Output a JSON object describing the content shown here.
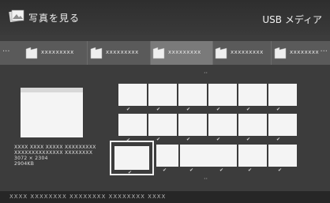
{
  "header": {
    "title": "写真を見る",
    "media": "USB メディア",
    "title_icon": "photo-icon"
  },
  "folder_strip": {
    "more_left": "···",
    "more_right": "···",
    "folders": [
      {
        "label": "xxxxxxxxx",
        "selected": false
      },
      {
        "label": "xxxxxxxxx",
        "selected": false
      },
      {
        "label": "xxxxxxxxx",
        "selected": true
      },
      {
        "label": "xxxxxxxxx",
        "selected": false
      },
      {
        "label": "xxxxxxxx",
        "selected": false
      }
    ]
  },
  "scroll": {
    "up": "··",
    "down": "··"
  },
  "preview": {
    "line1": "XXXX XXXX XXXXX XXXXXXXXX",
    "line2": "XXXXXXXXXXXXXX XXXXXXXX",
    "resolution": "3072 × 2304",
    "size": "2904KB"
  },
  "thumbnails": {
    "check_mark": "✔"
  },
  "footer": {
    "text": "XXXX  XXXXXXXX  XXXXXXXX  XXXXXXXX  XXXX"
  },
  "colors": {
    "background": "#3c3c3c",
    "folder_strip": "#5a5a5a",
    "selected_folder": "#7a7a7a",
    "thumbnail": "#f4f4f4"
  }
}
